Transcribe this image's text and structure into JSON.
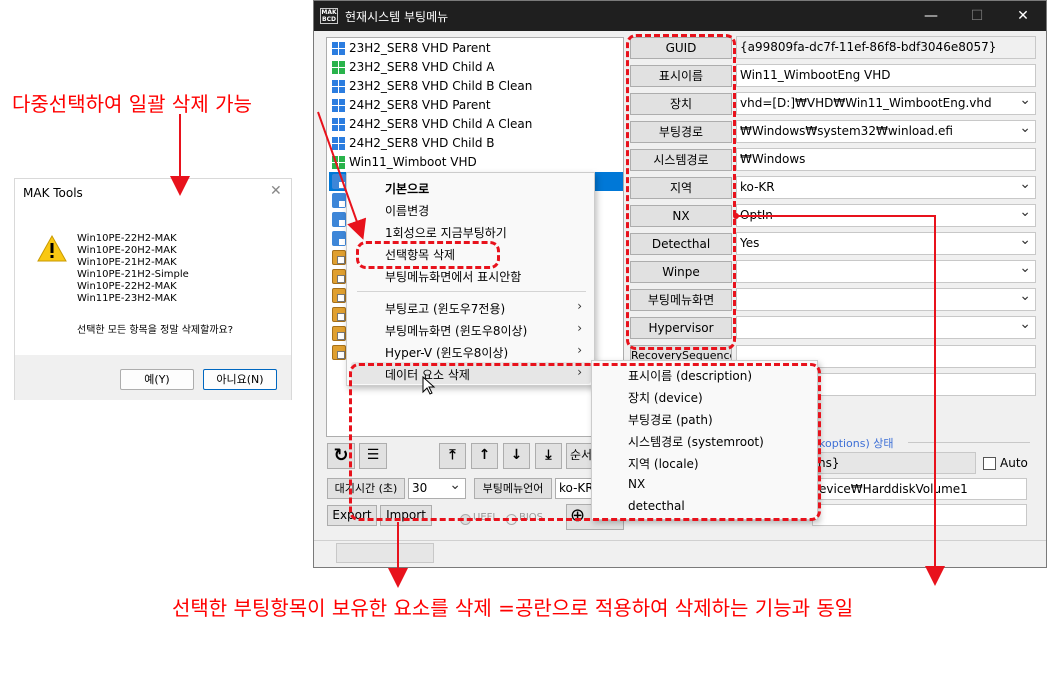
{
  "window": {
    "title": "현재시스템 부팅메뉴",
    "app_icon_text": "MAK BCD",
    "minimize": "—",
    "maximize": "☐",
    "close": "✕"
  },
  "entries": [
    {
      "label": "23H2_SER8 VHD Parent",
      "icon": "windows-logo-blue"
    },
    {
      "label": "23H2_SER8 VHD Child A",
      "icon": "windows-logo-green"
    },
    {
      "label": "23H2_SER8 VHD Child B Clean",
      "icon": "windows-logo-blue"
    },
    {
      "label": "24H2_SER8 VHD Parent",
      "icon": "windows-logo-blue"
    },
    {
      "label": "24H2_SER8 VHD Child A Clean",
      "icon": "windows-logo-blue"
    },
    {
      "label": "24H2_SER8 VHD Child B",
      "icon": "windows-logo-blue"
    },
    {
      "label": "Win11_Wimboot VHD",
      "icon": "windows-logo-green"
    }
  ],
  "fields": [
    {
      "name": "GUID",
      "value": "{a99809fa-dc7f-11ef-86f8-bdf3046e8057}",
      "readonly": true,
      "combo": false
    },
    {
      "name": "표시이름",
      "value": "Win11_WimbootEng VHD",
      "readonly": false,
      "combo": false
    },
    {
      "name": "장치",
      "value": "vhd=[D:]₩VHD₩Win11_WimbootEng.vhd",
      "readonly": false,
      "combo": true
    },
    {
      "name": "부팅경로",
      "value": "₩Windows₩system32₩winload.efi",
      "readonly": false,
      "combo": true
    },
    {
      "name": "시스템경로",
      "value": "₩Windows",
      "readonly": false,
      "combo": false
    },
    {
      "name": "지역",
      "value": "ko-KR",
      "readonly": false,
      "combo": true
    },
    {
      "name": "NX",
      "value": "OptIn",
      "readonly": false,
      "combo": true
    },
    {
      "name": "Detecthal",
      "value": "Yes",
      "readonly": false,
      "combo": true
    },
    {
      "name": "Winpe",
      "value": "",
      "readonly": false,
      "combo": true
    },
    {
      "name": "부팅메뉴화면",
      "value": "",
      "readonly": false,
      "combo": true
    },
    {
      "name": "Hypervisor",
      "value": "",
      "readonly": false,
      "combo": true
    }
  ],
  "lower_panel": {
    "partial_label": "RecoverySequence",
    "group_label": "koptions) 상태",
    "options_value": "ns}",
    "auto_label": "Auto",
    "device_value": "evice₩HarddiskVolume1"
  },
  "toolbar": {
    "refresh_icon": "↻",
    "list_icon": "☰",
    "move_top": "⤒",
    "move_up": "↑",
    "move_down": "↓",
    "move_bottom": "⤓",
    "order_label": "순서",
    "timeout_label": "대기시간 (초)",
    "timeout_value": "30",
    "menu_lang_label": "부팅메뉴언어",
    "menu_lang_value": "ko-KR",
    "export_label": "Export",
    "import_label": "Import",
    "uefi_label": "UEFI",
    "bios_label": "BIOS",
    "add_icon": "⊕"
  },
  "context_menu": {
    "items": [
      "기본으로",
      "이름변경",
      "1회성으로 지금부팅하기",
      "선택항목 삭제",
      "부팅메뉴화면에서 표시안함"
    ],
    "sub_items": [
      "부팅로고 (윈도우7전용)",
      "부팅메뉴화면 (윈도우8이상)",
      "Hyper-V (윈도우8이상)",
      "데이터 요소 삭제"
    ],
    "submenu_arrow": "›"
  },
  "submenu": {
    "items": [
      "표시이름 (description)",
      "장치 (device)",
      "부팅경로 (path)",
      "시스템경로 (systemroot)",
      "지역 (locale)",
      "NX",
      "detecthal"
    ]
  },
  "dialog": {
    "title": "MAK Tools",
    "close": "✕",
    "lines": [
      "Win10PE-22H2-MAK",
      "Win10PE-20H2-MAK",
      "Win10PE-21H2-MAK",
      "Win10PE-21H2-Simple",
      "Win10PE-22H2-MAK",
      "Win11PE-23H2-MAK"
    ],
    "question": "선택한 모든 항목을 정말 삭제할까요?",
    "yes": "예(Y)",
    "no": "아니요(N)"
  },
  "annotations": {
    "top_left": "다중선택하여 일괄 삭제 가능",
    "bottom": "선택한 부팅항목이 보유한 요소를 삭제 =공란으로 적용하여 삭제하는 기능과 동일",
    "color": "#ff0000"
  }
}
